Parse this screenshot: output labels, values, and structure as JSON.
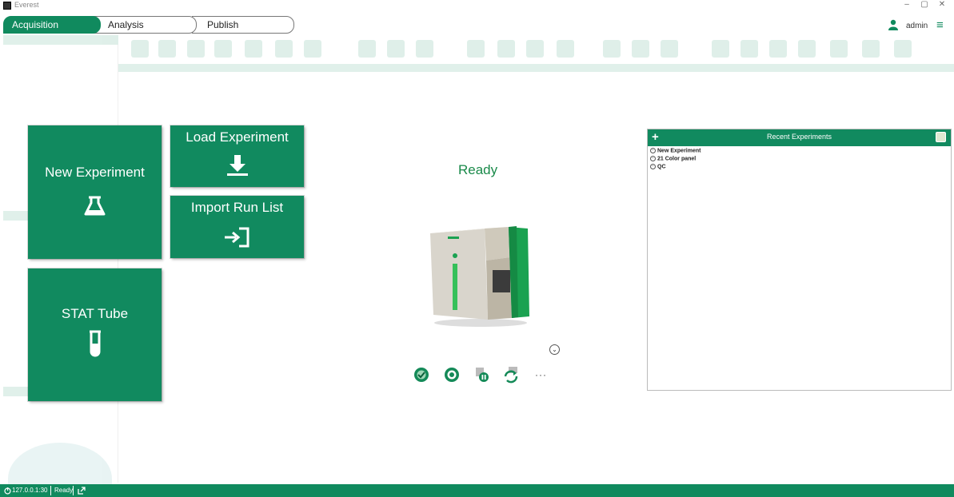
{
  "window": {
    "title": "Everest",
    "minimize": "–",
    "maximize": "▢",
    "close": "✕"
  },
  "tabs": [
    {
      "label": "Acquisition",
      "active": true
    },
    {
      "label": "Analysis",
      "active": false
    },
    {
      "label": "Publish",
      "active": false
    }
  ],
  "user": {
    "name": "admin",
    "icon": "user-icon"
  },
  "menu": {
    "glyph": "≡",
    "icon": "hamburger-menu-icon"
  },
  "tiles": {
    "new_experiment": {
      "label": "New Experiment",
      "icon": "flask-icon"
    },
    "load_experiment": {
      "label": "Load Experiment",
      "icon": "download-icon"
    },
    "import_run_list": {
      "label": "Import Run List",
      "icon": "import-icon"
    },
    "stat_tube": {
      "label": "STAT Tube",
      "icon": "test-tube-icon"
    }
  },
  "status": {
    "title": "Ready"
  },
  "instrument_actions": {
    "expand_glyph": "⌄",
    "more_label": "···",
    "icons": [
      "qc-check-icon",
      "startup-icon",
      "pause-icon",
      "refresh-icon"
    ]
  },
  "recent_experiments": {
    "title": "Recent Experiments",
    "add_glyph": "+",
    "toggle_glyph": "−",
    "items": [
      {
        "label": "New Experiment"
      },
      {
        "label": "21 Color panel"
      },
      {
        "label": "QC"
      }
    ]
  },
  "statusbar": {
    "address": "127.0.0.1:30",
    "state": "Ready"
  },
  "colors": {
    "brand_green": "#118a5f",
    "status_text": "#1a8a4a"
  }
}
